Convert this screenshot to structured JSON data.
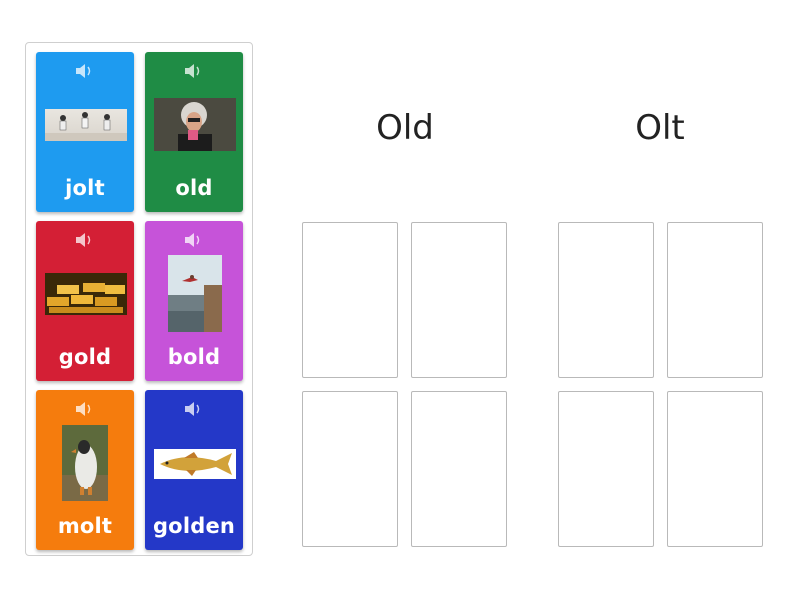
{
  "cards": [
    {
      "word": "jolt",
      "color": "#1e9bf0",
      "image": "people-jumping-photo",
      "speaker_icon": "speaker-icon"
    },
    {
      "word": "old",
      "color": "#1f8c45",
      "image": "old-woman-with-cards-photo",
      "speaker_icon": "speaker-icon"
    },
    {
      "word": "gold",
      "color": "#d41f35",
      "image": "gold-bars-photo",
      "speaker_icon": "speaker-icon"
    },
    {
      "word": "bold",
      "color": "#c653d9",
      "image": "cliff-jumper-photo",
      "speaker_icon": "speaker-icon"
    },
    {
      "word": "molt",
      "color": "#f57c0d",
      "image": "molting-penguin-photo",
      "speaker_icon": "speaker-icon"
    },
    {
      "word": "golden",
      "color": "#2438c8",
      "image": "golden-fish-photo",
      "speaker_icon": "speaker-icon"
    }
  ],
  "groups": [
    {
      "title": "Old"
    },
    {
      "title": "Olt"
    }
  ]
}
